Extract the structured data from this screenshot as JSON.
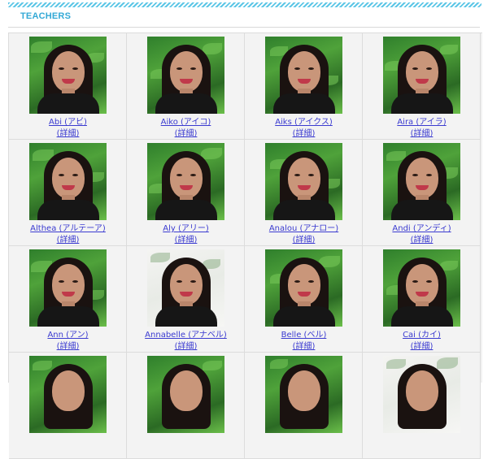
{
  "header": {
    "title": "TEACHERS"
  },
  "teachers": [
    {
      "name": "Abi (アビ)",
      "detail": "(詳細)"
    },
    {
      "name": "Aiko (アイコ)",
      "detail": "(詳細)"
    },
    {
      "name": "Aiks (アイクス)",
      "detail": "(詳細)"
    },
    {
      "name": "Aira (アイラ)",
      "detail": "(詳細)"
    },
    {
      "name": "Althea (アルテーア)",
      "detail": "(詳細)"
    },
    {
      "name": "Aly (アリー)",
      "detail": "(詳細)"
    },
    {
      "name": "Analou (アナロー)",
      "detail": "(詳細)"
    },
    {
      "name": "Andi (アンディ)",
      "detail": "(詳細)"
    },
    {
      "name": "Ann (アン)",
      "detail": "(詳細)"
    },
    {
      "name": "Annabelle (アナベル)",
      "detail": "(詳細)"
    },
    {
      "name": "Belle (ベル)",
      "detail": "(詳細)"
    },
    {
      "name": "Cai (カイ)",
      "detail": "(詳細)"
    },
    {
      "name": "",
      "detail": ""
    },
    {
      "name": "",
      "detail": ""
    },
    {
      "name": "",
      "detail": ""
    },
    {
      "name": "",
      "detail": ""
    }
  ]
}
